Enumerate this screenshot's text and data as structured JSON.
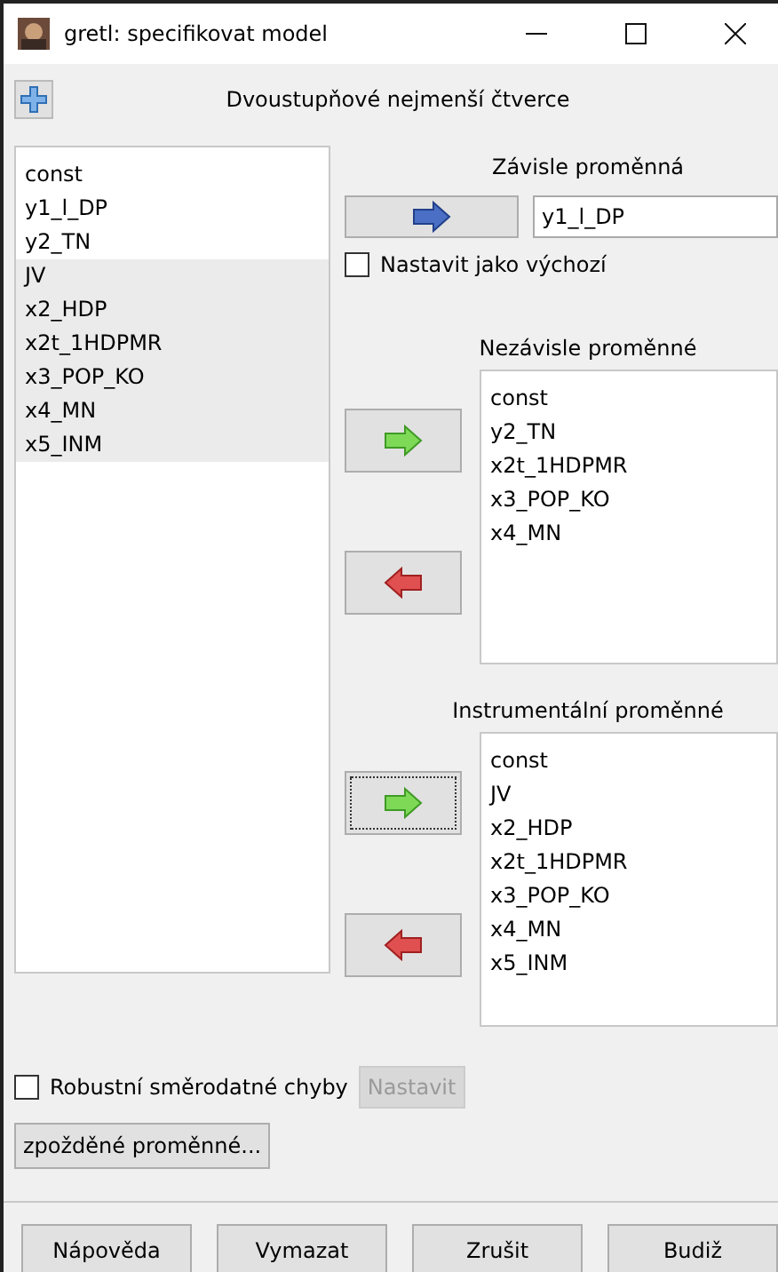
{
  "window": {
    "title": "gretl: specifikovat model"
  },
  "heading": "Dvoustupňové nejmenší čtverce",
  "available": {
    "items": [
      {
        "label": "const",
        "selected": false
      },
      {
        "label": "y1_l_DP",
        "selected": false
      },
      {
        "label": "y2_TN",
        "selected": false
      },
      {
        "label": "JV",
        "selected": true
      },
      {
        "label": "x2_HDP",
        "selected": true
      },
      {
        "label": "x2t_1HDPMR",
        "selected": true
      },
      {
        "label": "x3_POP_KO",
        "selected": true
      },
      {
        "label": "x4_MN",
        "selected": true
      },
      {
        "label": "x5_INM",
        "selected": true
      }
    ]
  },
  "dependent": {
    "title": "Závisle proměnná",
    "arrow": {
      "kind": "set"
    },
    "value": "y1_l_DP"
  },
  "default_checkbox": {
    "label": "Nastavit jako výchozí",
    "checked": false
  },
  "independent": {
    "title": "Nezávisle proměnné",
    "arrows": [
      {
        "kind": "add",
        "focused": false
      },
      {
        "kind": "remove",
        "focused": false
      }
    ],
    "items": [
      "const",
      "y2_TN",
      "x2t_1HDPMR",
      "x3_POP_KO",
      "x4_MN"
    ]
  },
  "instruments": {
    "title": "Instrumentální proměnné",
    "arrows": [
      {
        "kind": "add",
        "focused": true
      },
      {
        "kind": "remove",
        "focused": false
      }
    ],
    "items": [
      "const",
      "JV",
      "x2_HDP",
      "x2t_1HDPMR",
      "x3_POP_KO",
      "x4_MN",
      "x5_INM"
    ]
  },
  "robust": {
    "label": "Robustní směrodatné chyby",
    "checked": false,
    "button": {
      "label": "Nastavit",
      "disabled": true
    }
  },
  "lags_button": "zpožděné proměnné...",
  "buttons": [
    "Nápověda",
    "Vymazat",
    "Zrušit",
    "Budiž"
  ]
}
